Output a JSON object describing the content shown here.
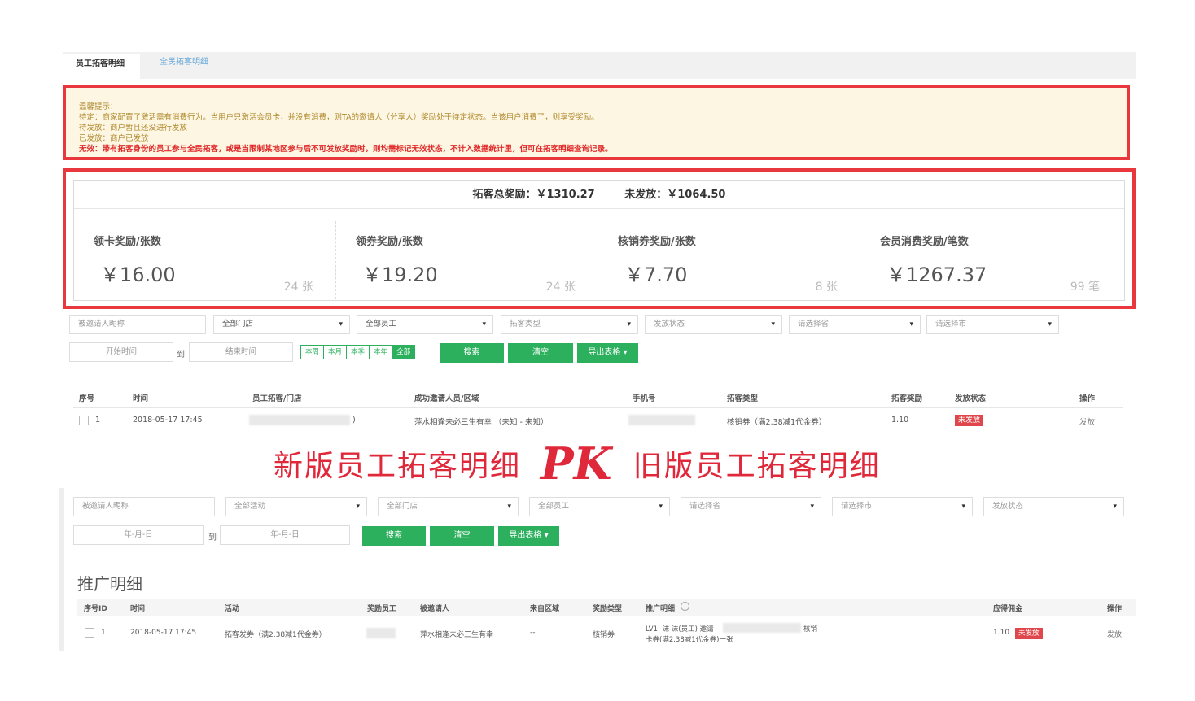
{
  "tabs": [
    {
      "label": "员工拓客明细",
      "active": true
    },
    {
      "label": "全民拓客明细",
      "active": false
    }
  ],
  "notice": {
    "lines": [
      "温馨提示：",
      "待定：商家配置了激活需有消费行为。当用户只激活会员卡，并没有消费，则TA的邀请人（分享人）奖励处于待定状态。当该用户消费了，则享受奖励。",
      "待发放：商户暂且还没进行发放",
      "已发放：商户已发放",
      "无效：带有拓客身份的员工参与全民拓客，或是当限制某地区参与后不可发放奖励时，则均需标记无效状态，不计入数据统计里，但可在拓客明细查询记录。"
    ]
  },
  "summary": {
    "total": "拓客总奖励：￥1310.27",
    "unpaid": "未发放：￥1064.50"
  },
  "stats": [
    {
      "title": "领卡奖励/张数",
      "amount": "￥16.00",
      "count": "24 张"
    },
    {
      "title": "领券奖励/张数",
      "amount": "￥19.20",
      "count": "24 张"
    },
    {
      "title": "核销券奖励/张数",
      "amount": "￥7.70",
      "count": "8 张"
    },
    {
      "title": "会员消费奖励/笔数",
      "amount": "￥1267.37",
      "count": "99 笔"
    }
  ],
  "new_filters": {
    "inviter_placeholder": "被邀请人昵称",
    "store": "全部门店",
    "staff": "全部员工",
    "type": "拓客类型",
    "status": "发放状态",
    "province": "请选择省",
    "city": "请选择市",
    "start": "开始时间",
    "to": "到",
    "end": "结束时间",
    "periods": [
      "本周",
      "本月",
      "本季",
      "本年",
      "全部"
    ],
    "search": "搜索",
    "clear": "清空",
    "export": "导出表格 ▾"
  },
  "new_table": {
    "headers": [
      "序号",
      "时间",
      "员工拓客/门店",
      "成功邀请人员/区域",
      "手机号",
      "拓客类型",
      "拓客奖励",
      "发放状态",
      "操作"
    ],
    "row": {
      "index": "1",
      "time": "2018-05-17 17:45",
      "staff_suffix": ")",
      "invitee": "萍水相逢未必三生有幸 （未知 - 未知）",
      "type": "核销券（满2.38减1代金券）",
      "reward": "1.10",
      "status": "未发放",
      "action": "发放"
    }
  },
  "banner": {
    "left": "新版员工拓客明细",
    "pk": "PK",
    "right": "旧版员工拓客明细"
  },
  "old_filters": {
    "inviter_placeholder": "被邀请人昵称",
    "activity": "全部活动",
    "store": "全部门店",
    "staff": "全部员工",
    "province": "请选择省",
    "city": "请选择市",
    "status": "发放状态",
    "start": "年-月-日",
    "to": "到",
    "end": "年-月-日",
    "search": "搜索",
    "clear": "清空",
    "export": "导出表格 ▾"
  },
  "old_table": {
    "title": "推广明细",
    "headers": [
      "序号ID",
      "时间",
      "活动",
      "奖励员工",
      "被邀请人",
      "来自区域",
      "奖励类型",
      "推广明细",
      "应得佣金",
      "操作"
    ],
    "row": {
      "index": "1",
      "time": "2018-05-17 17:45",
      "activity": "拓客发券（满2.38减1代金券）",
      "invitee": "萍水相逢未必三生有幸",
      "region": "--",
      "type": "核销券",
      "detail_line1": "LV1: 沫 沫(员工) 邀请",
      "detail_line1_end": "核销",
      "detail_line2": "卡券(满2.38减1代金券)一张",
      "commission": "1.10",
      "status": "未发放",
      "action": "发放"
    }
  },
  "colors": {
    "highlight_border": "#e8383d",
    "primary_green": "#2db05e",
    "badge_red": "#e0474c",
    "banner_red": "#e0283b",
    "notice_bg": "#fdf6e3"
  }
}
